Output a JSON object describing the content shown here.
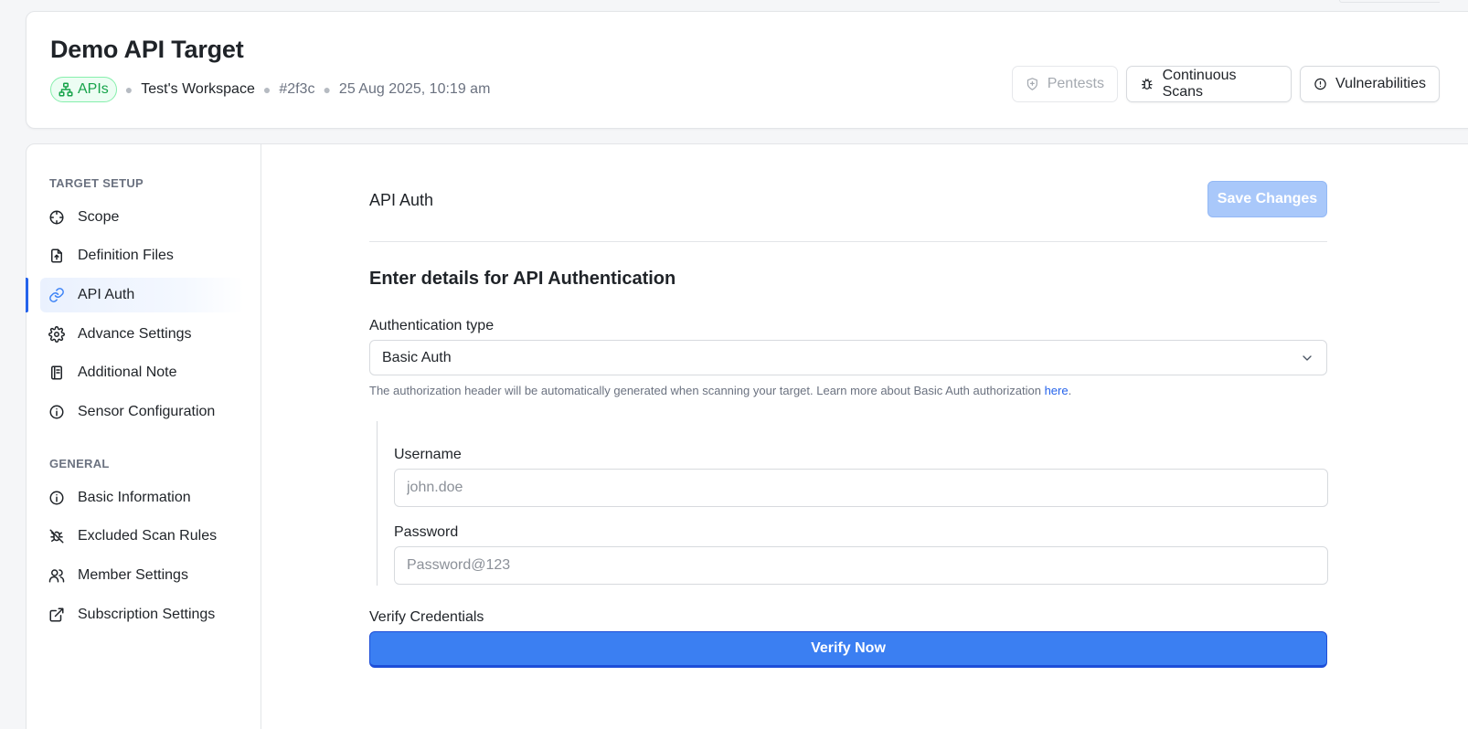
{
  "header": {
    "title": "Demo API Target",
    "type_badge": "APIs",
    "workspace": "Test's Workspace",
    "target_id": "#2f3c",
    "timestamp": "25 Aug 2025, 10:19 am",
    "buttons": {
      "pentests": "Pentests",
      "continuous_scans": "Continuous Scans",
      "vulnerabilities": "Vulnerabilities"
    }
  },
  "sidebar": {
    "target_setup_title": "TARGET SETUP",
    "general_title": "GENERAL",
    "target_setup_items": [
      {
        "label": "Scope",
        "icon": "crosshair-icon"
      },
      {
        "label": "Definition Files",
        "icon": "file-upload-icon"
      },
      {
        "label": "API Auth",
        "icon": "link-icon",
        "active": true
      },
      {
        "label": "Advance Settings",
        "icon": "gear-icon"
      },
      {
        "label": "Additional Note",
        "icon": "notebook-icon"
      },
      {
        "label": "Sensor Configuration",
        "icon": "info-icon"
      }
    ],
    "general_items": [
      {
        "label": "Basic Information",
        "icon": "info-icon"
      },
      {
        "label": "Excluded Scan Rules",
        "icon": "bug-off-icon"
      },
      {
        "label": "Member Settings",
        "icon": "users-icon"
      },
      {
        "label": "Subscription Settings",
        "icon": "external-link-icon"
      }
    ]
  },
  "content": {
    "title": "API Auth",
    "save_label": "Save Changes",
    "form_heading": "Enter details for API Authentication",
    "auth_type_label": "Authentication type",
    "auth_type_value": "Basic Auth",
    "help_text": "The authorization header will be automatically generated when scanning your target. Learn more about Basic Auth authorization ",
    "help_link": "here",
    "help_suffix": ".",
    "username_label": "Username",
    "username_placeholder": "john.doe",
    "password_label": "Password",
    "password_placeholder": "Password@123",
    "verify_label": "Verify Credentials",
    "verify_button": "Verify Now"
  },
  "colors": {
    "accent": "#3b7ff2",
    "badge_green": "#16a34a",
    "save_disabled": "#a9c8fa"
  }
}
